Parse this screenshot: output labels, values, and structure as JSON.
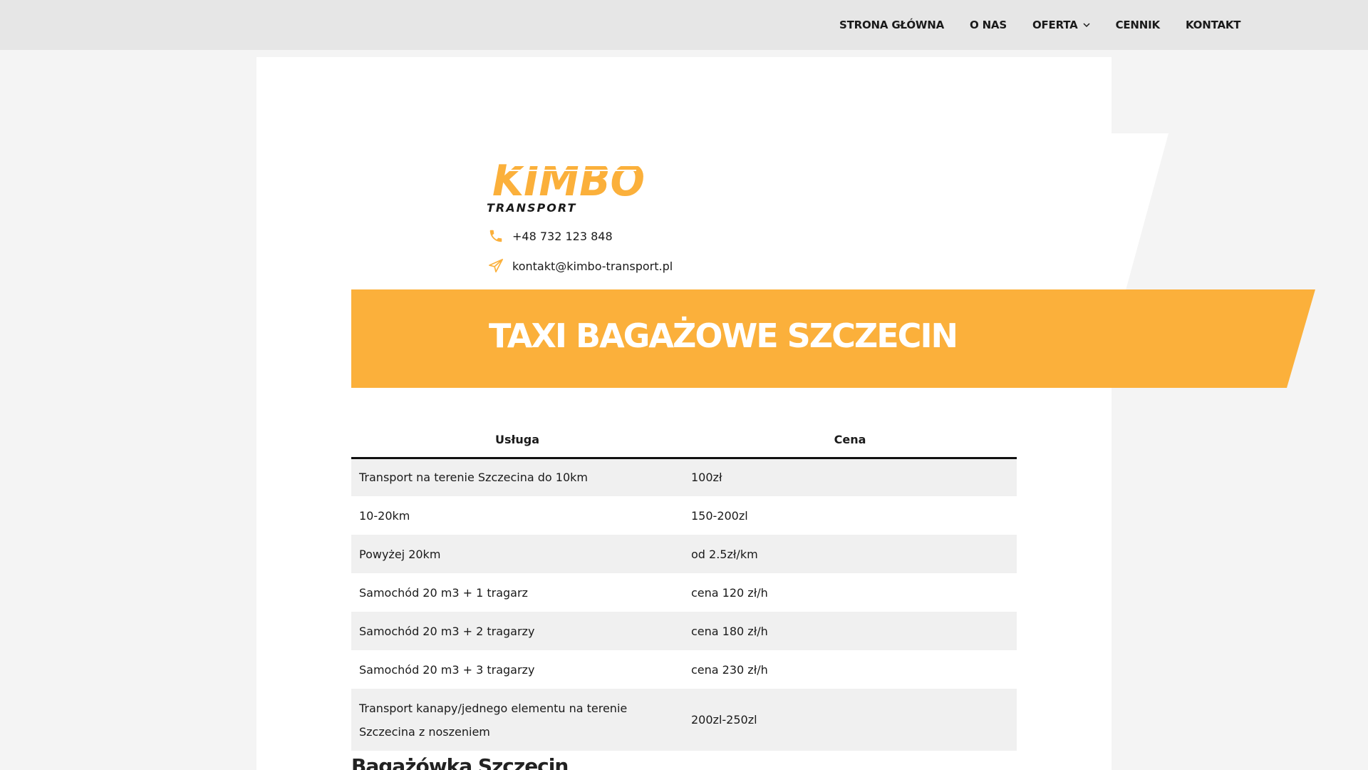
{
  "nav": {
    "items": [
      {
        "label": "STRONA GŁÓWNA"
      },
      {
        "label": "O NAS"
      },
      {
        "label": "OFERTA"
      },
      {
        "label": "CENNIK"
      },
      {
        "label": "KONTAKT"
      }
    ]
  },
  "logo": {
    "brand": "KIMBO",
    "tagline": "TRANSPORT"
  },
  "contact": {
    "phone": "+48 732 123 848",
    "email": "kontakt@kimbo-transport.pl"
  },
  "banner": {
    "title": "TAXI BAGAŻOWE SZCZECIN"
  },
  "table": {
    "headers": [
      "Usługa",
      "Cena"
    ],
    "rows": [
      {
        "service": "Transport na terenie Szczecina do 10km",
        "price": "100zł"
      },
      {
        "service": "10-20km",
        "price": "150-200zl"
      },
      {
        "service": "Powyżej 20km",
        "price": "od 2.5zł/km"
      },
      {
        "service": "Samochód 20 m3 + 1 tragarz",
        "price": "cena 120 zł/h"
      },
      {
        "service": "Samochód 20 m3 + 2 tragarzy",
        "price": "cena 180 zł/h"
      },
      {
        "service": "Samochód 20 m3 + 3 tragarzy",
        "price": "cena 230 zł/h"
      },
      {
        "service_line1": "Transport kanapy/jednego elementu na terenie",
        "service_line2": "Szczecina z noszeniem",
        "price": "200zl-250zl"
      }
    ]
  },
  "section": {
    "subheading": "Bagażówka Szczecin"
  },
  "colors": {
    "accent": "#fbb03b",
    "nav_bg": "#e6e6e6",
    "row_alt": "#f0f0f0"
  }
}
